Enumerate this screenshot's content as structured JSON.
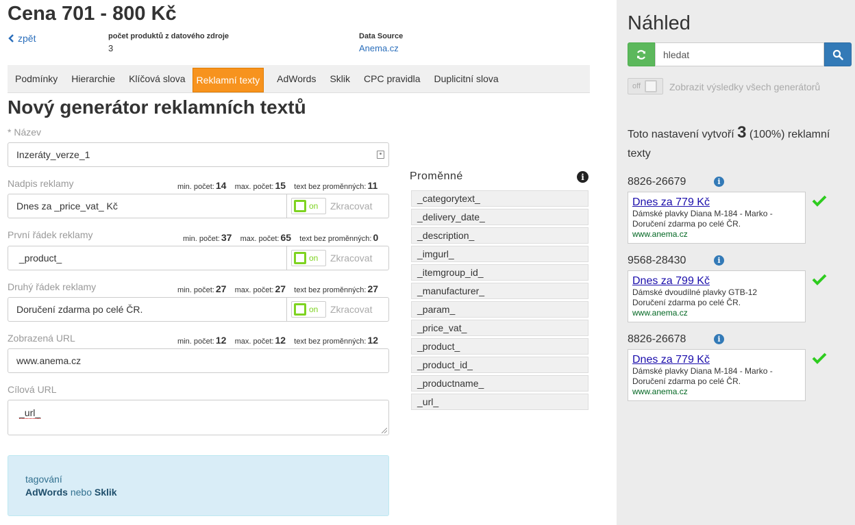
{
  "header": {
    "title": "Cena 701 - 800 Kč",
    "back_label": "zpět",
    "products_label": "počet produktů z datového zdroje",
    "products_value": "3",
    "source_label": "Data Source",
    "source_value": "Anema.cz"
  },
  "tabs": [
    {
      "label": "Podmínky"
    },
    {
      "label": "Hierarchie"
    },
    {
      "label": "Klíčová slova"
    },
    {
      "label": "Reklamní texty",
      "active": true
    },
    {
      "label": "AdWords"
    },
    {
      "label": "Sklik"
    },
    {
      "label": "CPC pravidla"
    },
    {
      "label": "Duplicitní slova"
    }
  ],
  "form": {
    "title": "Nový generátor reklamních textů",
    "name_required": "*",
    "name_label": "Název",
    "name_value": "Inzeráty_verze_1",
    "toggle_on": "on",
    "shorten_label": "Zkracovat",
    "min_label": "min. počet:",
    "max_label": "max. počet:",
    "novar_label": "text bez proměnných:",
    "headline": {
      "label": "Nadpis reklamy",
      "value": "Dnes za  _price_vat_ Kč",
      "min": "14",
      "max": "15",
      "novar": "11"
    },
    "line1": {
      "label": "První řádek reklamy",
      "value": " _product_",
      "min": "37",
      "max": "65",
      "novar": "0"
    },
    "line2": {
      "label": "Druhý řádek reklamy",
      "value": "Doručení zdarma po celé ČR.",
      "min": "27",
      "max": "27",
      "novar": "27"
    },
    "display_url": {
      "label": "Zobrazená URL",
      "value": "www.anema.cz",
      "min": "12",
      "max": "12",
      "novar": "12"
    },
    "target_url": {
      "label": "Cílová URL",
      "value": "_url_"
    },
    "tagging": {
      "title": "tagování",
      "adwords": "AdWords",
      "or": "nebo",
      "sklik": "Sklik"
    }
  },
  "variables": {
    "title": "Proměnné",
    "items": [
      "_categorytext_",
      "_delivery_date_",
      "_description_",
      "_imgurl_",
      "_itemgroup_id_",
      "_manufacturer_",
      "_param_",
      "_price_vat_",
      "_product_",
      "_product_id_",
      "_productname_",
      "_url_"
    ]
  },
  "preview": {
    "title": "Náhled",
    "search_placeholder": "hledat",
    "all_toggle": "off",
    "all_label": "Zobrazit výsledky všech generátorů",
    "summary_pre": "Toto nastavení vytvoří",
    "summary_count": "3",
    "summary_post": "(100%) reklamní texty",
    "results": [
      {
        "id": "8826-26679",
        "headline": "Dnes za 779 Kč",
        "line1": "Dámské plavky Diana M-184 - Marko -",
        "line2": "Doručení zdarma po celé ČR.",
        "url": "www.anema.cz"
      },
      {
        "id": "9568-28430",
        "headline": "Dnes za 799 Kč",
        "line1": "Dámské dvoudílné plavky GTB-12",
        "line2": "Doručení zdarma po celé ČR.",
        "url": "www.anema.cz"
      },
      {
        "id": "8826-26678",
        "headline": "Dnes za 779 Kč",
        "line1": "Dámské plavky Diana M-184 - Marko -",
        "line2": "Doručení zdarma po celé ČR.",
        "url": "www.anema.cz"
      }
    ]
  },
  "colors": {
    "active_tab": "#f7931e",
    "toggle_on": "#7ed321",
    "link": "#2a6ebb",
    "check": "#2ecc1f"
  }
}
